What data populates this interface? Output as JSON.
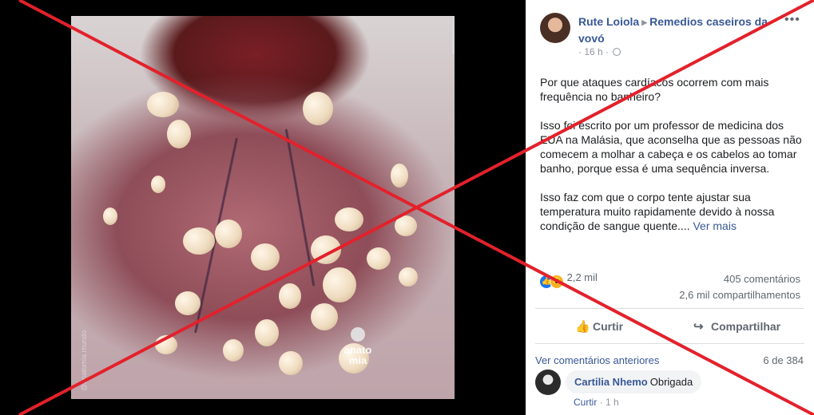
{
  "post": {
    "author": "Rute Loiola",
    "arrow": "▶",
    "group": "Remedios caseiros da vovó",
    "time": "16 h",
    "dot": "·",
    "more": "•••",
    "paragraph1": "Por que ataques cardíacos ocorrem com mais frequência no banheiro?",
    "paragraph2": "Isso foi escrito por um professor de medicina dos EUA na Malásia, que aconselha que as pessoas não comecem a molhar a cabeça e os cabelos ao tomar banho, porque essa é uma sequência inversa.",
    "paragraph3": "Isso faz com que o corpo tente ajustar sua temperatura muito rapidamente devido à nossa condição de sangue quente....",
    "see_more": "Ver mais"
  },
  "image": {
    "watermark_brand": "anato mia",
    "side_watermark": "@anatomia.mundo"
  },
  "engagement": {
    "reaction_count": "2,2 mil",
    "comments": "405 comentários",
    "shares": "2,6 mil compartilhamentos",
    "reaction_icons": [
      "like-icon",
      "wow-icon"
    ]
  },
  "actions": {
    "like_label": "Curtir",
    "share_label": "Compartilhar"
  },
  "comments": {
    "previous_label": "Ver comentários anteriores",
    "counter": "6 de 384",
    "item": {
      "author": "Cartilia Nhemo",
      "text": "Obrigada",
      "like": "Curtir",
      "sep": "·",
      "time": "1 h"
    }
  },
  "colors": {
    "link": "#385898",
    "cross": "#e3212b",
    "muted": "#606770"
  }
}
